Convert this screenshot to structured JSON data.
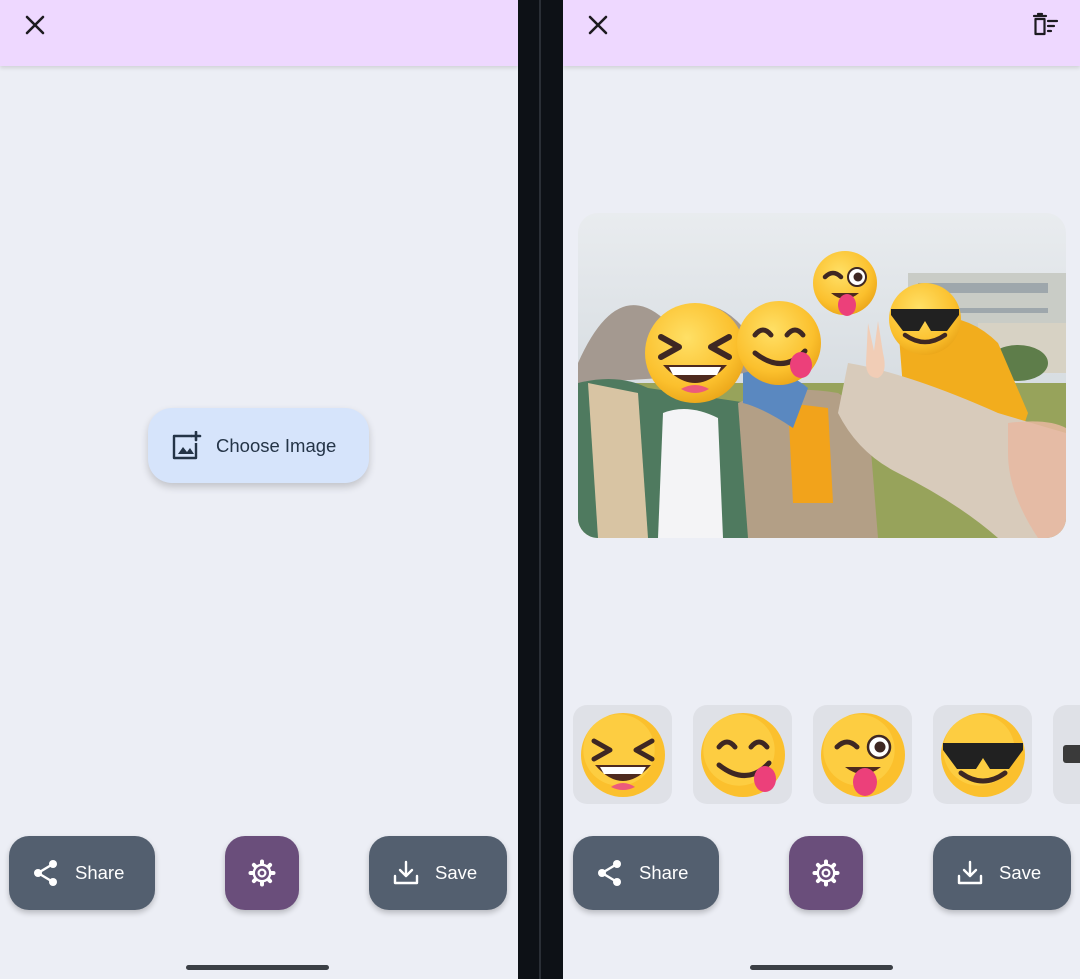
{
  "left_screen": {
    "choose_image_label": "Choose Image",
    "share_label": "Share",
    "save_label": "Save"
  },
  "right_screen": {
    "share_label": "Share",
    "save_label": "Save",
    "emoji_tray": [
      "grinning-squinting-face",
      "face-savoring-food",
      "winking-face-with-tongue",
      "smiling-face-with-sunglasses",
      "partially-visible-emoji"
    ]
  },
  "colors": {
    "top_bar": "#eed8ff",
    "screen_bg": "#eceef5",
    "choose_button": "#d6e4fb",
    "action_button": "#535f6f",
    "settings_button": "#6a4e7b"
  }
}
